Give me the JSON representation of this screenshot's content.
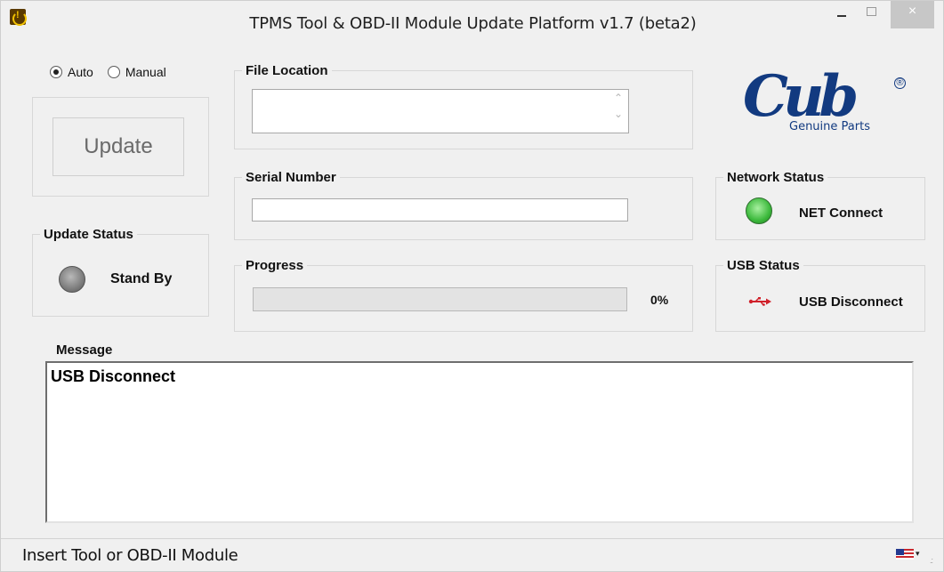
{
  "window": {
    "title": "TPMS Tool & OBD-II Module Update Platform v1.7 (beta2)",
    "close_symbol": "×"
  },
  "mode": {
    "options": [
      {
        "label": "Auto",
        "selected": true
      },
      {
        "label": "Manual",
        "selected": false
      }
    ]
  },
  "update_button": {
    "label": "Update"
  },
  "file_location": {
    "legend": "File Location",
    "value": ""
  },
  "serial_number": {
    "legend": "Serial Number",
    "value": ""
  },
  "update_status": {
    "legend": "Update Status",
    "text": "Stand By",
    "led_color": "gray"
  },
  "progress": {
    "legend": "Progress",
    "value": 0,
    "text": "0%"
  },
  "network_status": {
    "legend": "Network Status",
    "text": "NET Connect",
    "led_color": "green"
  },
  "usb_status": {
    "legend": "USB Status",
    "text": "USB Disconnect",
    "icon": "usb-icon",
    "icon_color": "#d0202a"
  },
  "message": {
    "legend": "Message",
    "text": "USB Disconnect"
  },
  "logo": {
    "brand": "Cub",
    "tagline": "Genuine Parts",
    "reg": "®",
    "color": "#123a80"
  },
  "statusbar": {
    "text": "Insert Tool or OBD-II Module",
    "language_icon": "us-flag-icon"
  }
}
